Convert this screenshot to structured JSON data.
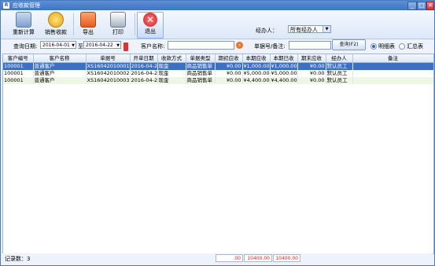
{
  "window": {
    "title": "应收款管理",
    "minimize": "_",
    "maximize": "□",
    "close": "✕",
    "icon_letter": "R"
  },
  "toolbar": {
    "buttons": [
      {
        "label": "重新计算",
        "icon": "recalc-icon"
      },
      {
        "label": "销售收款",
        "icon": "receipt-icon"
      },
      {
        "label": "导出",
        "icon": "export-icon"
      },
      {
        "label": "打印",
        "icon": "print-icon"
      },
      {
        "label": "退出",
        "icon": "exit-icon"
      }
    ],
    "agent_label": "经办人：",
    "agent_value": "所有经办人"
  },
  "query": {
    "date_label": "查询日期:",
    "date_from": "2016-04-01",
    "to_label": "至",
    "date_to": "2016-04-22",
    "customer_label": "客户名称:",
    "customer_value": "",
    "doc_label": "单据号/备注:",
    "doc_value": "",
    "query_button": "查询(F2)",
    "radio_detail": "明细表",
    "radio_summary": "汇总表"
  },
  "table": {
    "columns": [
      "客户编号",
      "客户名称",
      "单据号",
      "开单日期",
      "收款方式",
      "单据类型",
      "期初应收",
      "本期应收",
      "本期已收",
      "期末应收",
      "经办人",
      "备注"
    ],
    "rows": [
      [
        "100001",
        "普通客户",
        "XS16042010001",
        "2016-04-20",
        "现金",
        "商品销售单",
        "¥0.00",
        "¥1,000.00",
        "¥1,000.00",
        "¥0.00",
        "默认员工",
        ""
      ],
      [
        "100001",
        "普通客户",
        "XS16042010002",
        "2016-04-20",
        "现金",
        "商品销售单",
        "¥0.00",
        "¥5,000.00",
        "¥5,000.00",
        "¥0.00",
        "默认员工",
        ""
      ],
      [
        "100001",
        "普通客户",
        "XS16042010003",
        "2016-04-20",
        "现金",
        "商品销售单",
        "¥0.00",
        "¥4,400.00",
        "¥4,400.00",
        "¥0.00",
        "默认员工",
        ""
      ]
    ]
  },
  "status": {
    "records_label": "记录数：3",
    "total_opening": ".00",
    "total_current": "10400.00",
    "total_received": "10400.00"
  },
  "colors": {
    "title_bar": "#3f74c2",
    "selected_row": "#3d6fc3",
    "alt_row": "#eef7e4",
    "total_text": "#dd2222"
  }
}
